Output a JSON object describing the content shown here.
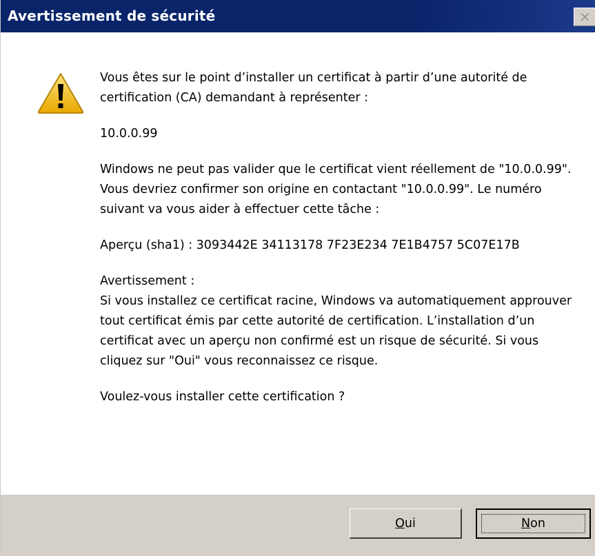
{
  "window": {
    "title": "Avertissement de sécurité",
    "close_glyph": "✕"
  },
  "icon": {
    "name": "warning-icon",
    "color": "#f2c230"
  },
  "message": {
    "intro": "Vous êtes sur le point d’installer un certificat à partir d’une autorité de certification (CA) demandant à représenter :",
    "host": "10.0.0.99",
    "validation": "Windows ne peut pas valider que le certificat vient réellement de \"10.0.0.99\". Vous devriez confirmer son origine en contactant \"10.0.0.99\". Le numéro suivant va vous aider à effectuer cette tâche :",
    "thumbprint": "Aperçu (sha1) : 3093442E 34113178 7F23E234 7E1B4757 5C07E17B",
    "warning_heading": "Avertissement :",
    "warning_body": "Si vous installez ce certificat racine, Windows va automatiquement approuver tout certificat émis par cette autorité de certification. L’installation d’un certificat avec un aperçu non confirmé est un risque de sécurité. Si vous cliquez sur \"Oui\" vous reconnaissez ce risque.",
    "question": "Voulez-vous installer cette certification ?"
  },
  "buttons": {
    "yes": {
      "mnemonic": "O",
      "rest": "ui"
    },
    "no": {
      "mnemonic": "N",
      "rest": "on"
    }
  },
  "colors": {
    "titlebar": "#0a246a",
    "button_face": "#d4d0c8"
  }
}
